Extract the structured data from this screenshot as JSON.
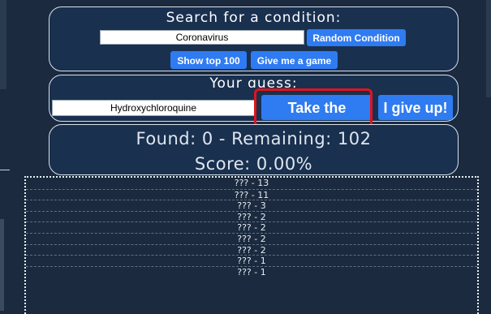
{
  "search": {
    "heading": "Search for a condition:",
    "value": "Coronavirus",
    "random_label": "Random Condition",
    "top100_label": "Show top 100",
    "game_label": "Give me a game"
  },
  "guess": {
    "heading": "Your guess:",
    "value": "Hydroxychloroquine",
    "take_label": "Take the guess",
    "giveup_label": "I give up!"
  },
  "stats": {
    "line": "Found: 0 - Remaining: 102",
    "score": "Score: 0.00%"
  },
  "results": [
    "??? - 13",
    "??? - 11",
    "??? - 3",
    "??? - 2",
    "??? - 2",
    "??? - 2",
    "??? - 2",
    "??? - 1",
    "??? - 1"
  ],
  "colors": {
    "background": "#1b2a3e",
    "panel": "#19304f",
    "button": "#2f7bf2",
    "highlight": "#e0141c"
  }
}
